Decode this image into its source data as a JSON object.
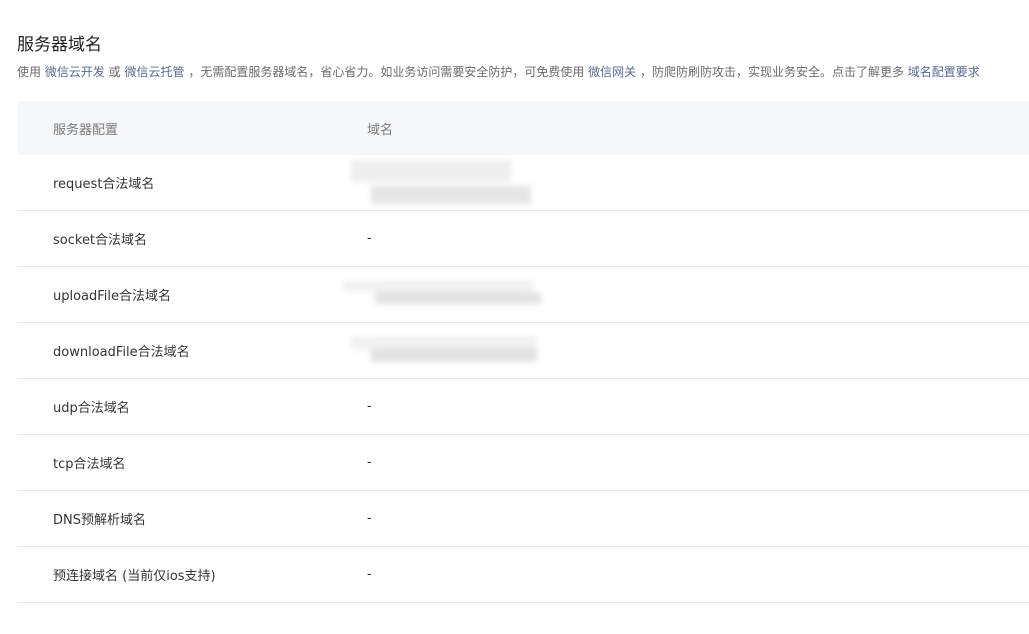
{
  "section": {
    "title": "服务器域名",
    "desc": {
      "prefix": "使用 ",
      "link1": "微信云开发",
      "text1": " 或 ",
      "link2": "微信云托管",
      "text2": " ，无需配置服务器域名，省心省力。如业务访问需要安全防护，可免费使用 ",
      "link3": "微信网关",
      "text3": " ，防爬防刷防攻击，实现业务安全。点击了解更多 ",
      "link4": "域名配置要求"
    }
  },
  "table": {
    "headers": [
      "服务器配置",
      "域名"
    ],
    "rows": [
      {
        "label": "request合法域名",
        "value": "",
        "redacted": true
      },
      {
        "label": "socket合法域名",
        "value": "-",
        "redacted": false
      },
      {
        "label": "uploadFile合法域名",
        "value": "",
        "redacted": true
      },
      {
        "label": "downloadFile合法域名",
        "value": "",
        "redacted": true
      },
      {
        "label": "udp合法域名",
        "value": "-",
        "redacted": false
      },
      {
        "label": "tcp合法域名",
        "value": "-",
        "redacted": false
      },
      {
        "label": "DNS预解析域名",
        "value": "-",
        "redacted": false
      },
      {
        "label": "预连接域名 (当前仅ios支持)",
        "value": "-",
        "redacted": false
      }
    ]
  }
}
